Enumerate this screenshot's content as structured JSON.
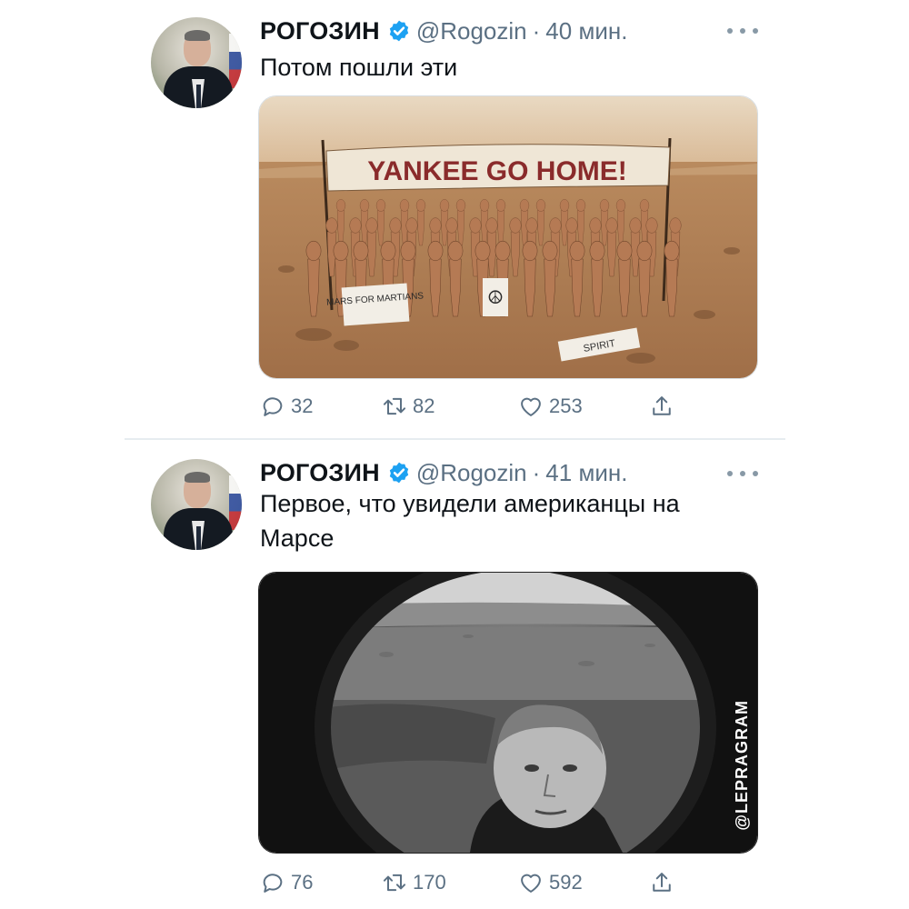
{
  "tweets": [
    {
      "author_name": "РОГОЗИН",
      "handle": "@Rogozin",
      "separator": "·",
      "time": "40 мин.",
      "text": "Потом пошли эти",
      "media": {
        "banner_text": "YANKEE GO HOME!",
        "sign_left": "MARS FOR MARTIANS",
        "sign_right_symbol": "☮",
        "sign_ground": "SPIRIT"
      },
      "stats": {
        "replies": "32",
        "retweets": "82",
        "likes": "253"
      }
    },
    {
      "author_name": "РОГОЗИН",
      "handle": "@Rogozin",
      "separator": "·",
      "time": "41 мин.",
      "text": "Первое, что увидели американцы на Марсе",
      "media": {
        "watermark": "@LEPRAGRAM"
      },
      "stats": {
        "replies": "76",
        "retweets": "170",
        "likes": "592"
      }
    }
  ],
  "colors": {
    "verified": "#1da1f2",
    "secondary_text": "#5b7083",
    "icon": "#5b7083",
    "divider": "#e6ecf0"
  }
}
